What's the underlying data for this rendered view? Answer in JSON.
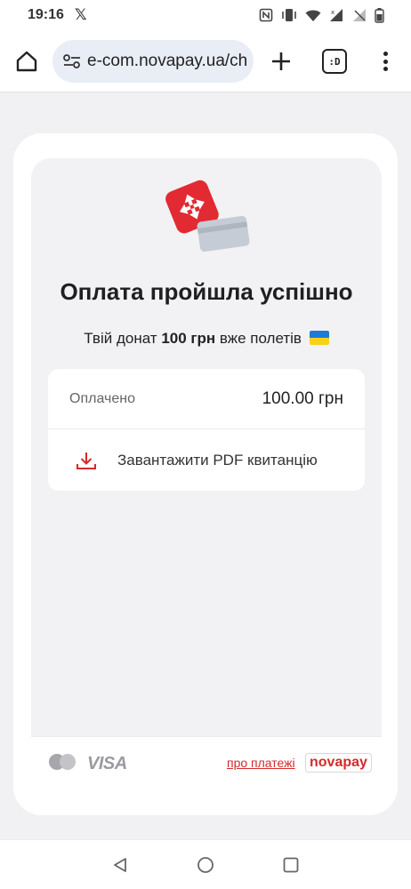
{
  "status_bar": {
    "time": "19:16",
    "x_app": "𝕏",
    "icons": [
      "nfc-icon",
      "vibrate-icon",
      "wifi-icon",
      "signal-icon",
      "signal-off-icon",
      "battery-icon"
    ]
  },
  "browser": {
    "url": "e-com.novapay.ua/ch",
    "tab_count": ":D",
    "icons": [
      "home-icon",
      "site-settings-icon",
      "plus-icon",
      "tabs-icon",
      "more-vert-icon"
    ]
  },
  "page": {
    "title": "Оплата пройшла успішно",
    "subtitle_prefix": "Твій донат ",
    "subtitle_amount": "100 грн",
    "subtitle_suffix": " вже полетів",
    "paid_label": "Оплачено",
    "paid_value": "100.00 грн",
    "download_label": "Завантажити PDF квитанцію"
  },
  "footer": {
    "visa": "VISA",
    "about_link": "про платежі",
    "brand": "novapay"
  },
  "colors": {
    "brand_red": "#d42a2a",
    "page_bg": "#f1f1f3",
    "pill_bg": "#e9edf6"
  },
  "nav": {
    "icons": [
      "back-icon",
      "home-nav-icon",
      "recents-icon"
    ]
  }
}
